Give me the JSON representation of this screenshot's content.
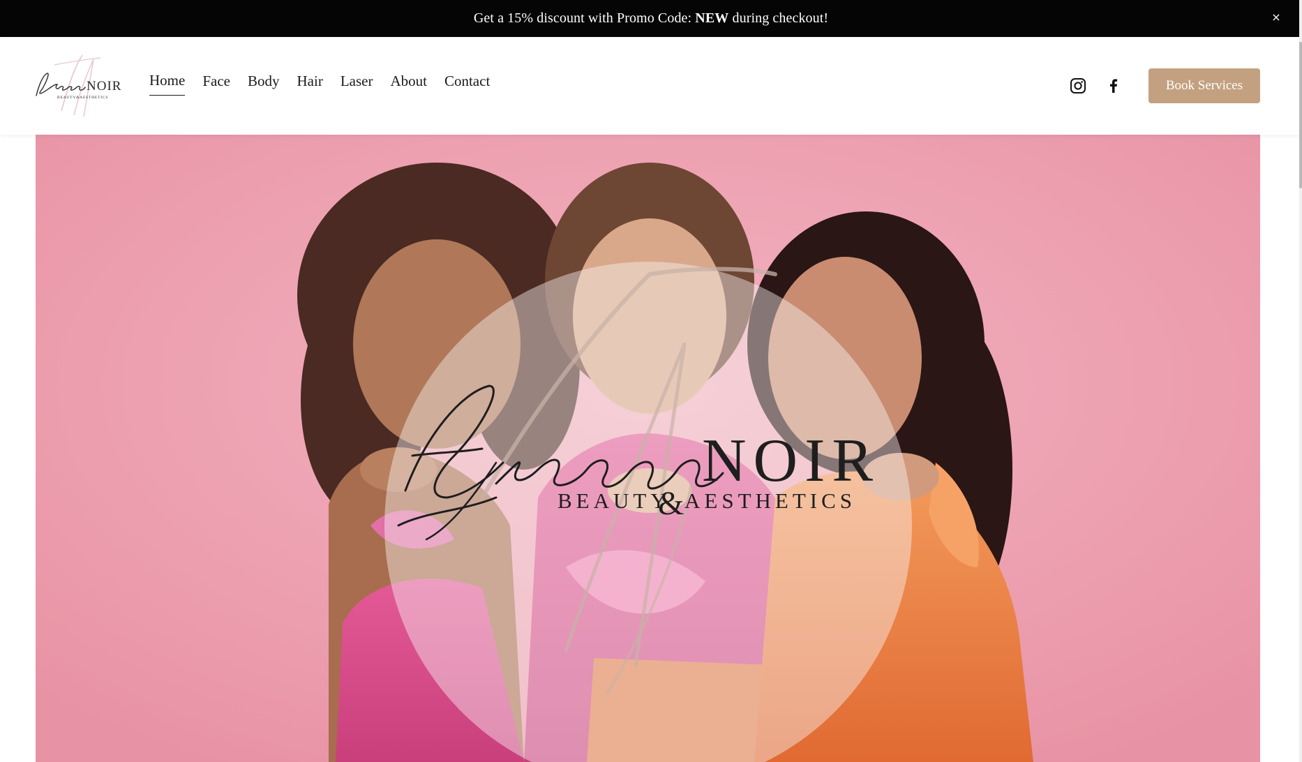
{
  "announcement": {
    "text_before": "Get a 15% discount with Promo Code: ",
    "code": "NEW",
    "text_after": " during checkout!",
    "close_glyph": "×"
  },
  "header": {
    "logo_icon": "elegance-noir-logo",
    "nav": [
      {
        "label": "Home",
        "active": true
      },
      {
        "label": "Face",
        "active": false
      },
      {
        "label": "Body",
        "active": false
      },
      {
        "label": "Hair",
        "active": false
      },
      {
        "label": "Laser",
        "active": false
      },
      {
        "label": "About",
        "active": false
      },
      {
        "label": "Contact",
        "active": false
      }
    ],
    "social": [
      "instagram-icon",
      "facebook-icon"
    ],
    "book_button": "Book Services"
  },
  "hero": {
    "brand_script": "Elegance",
    "brand_caps": "NOIR",
    "brand_tag_left": "BEAUTY",
    "brand_amp": "&",
    "brand_tag_right": "AESTHETICS"
  },
  "colors": {
    "announcement_bg": "#050505",
    "accent": "#c3a180",
    "hero_pink": "#ed9fb0",
    "text_dark": "#1a1a1a"
  }
}
